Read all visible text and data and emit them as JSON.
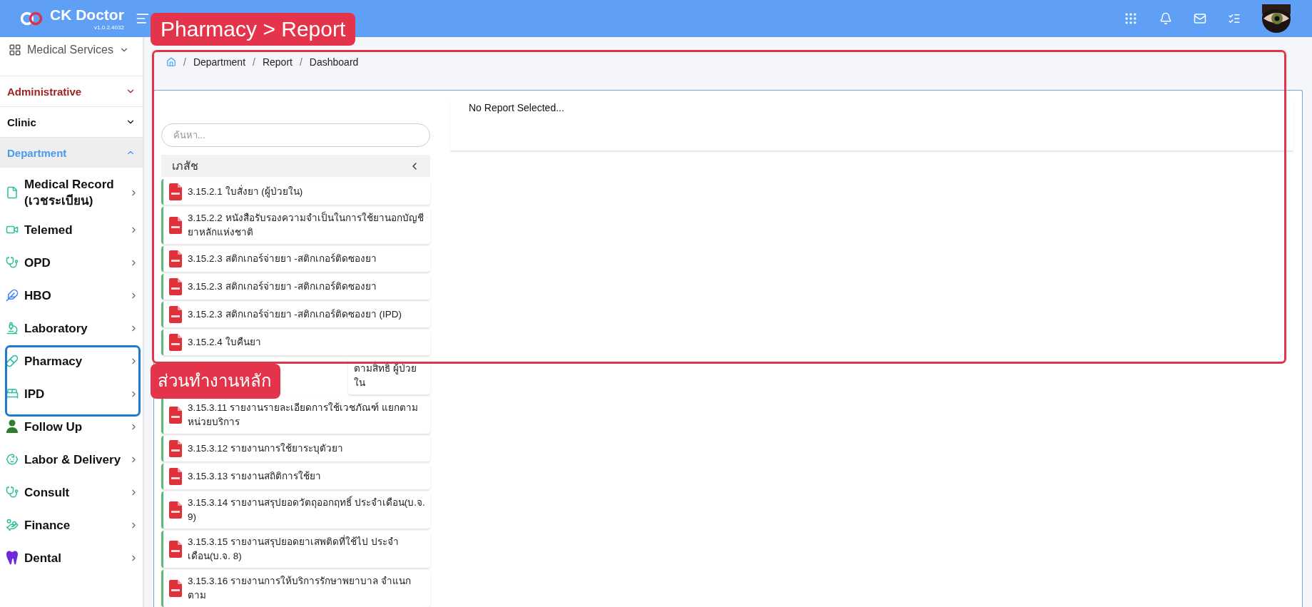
{
  "header": {
    "brand": "CK Doctor",
    "version": "v1.0.2.4032"
  },
  "sidebar": {
    "switcher": "Medical Services",
    "sections": [
      {
        "label": "Administrative",
        "color": "#9b2226",
        "expanded": false
      },
      {
        "label": "Clinic",
        "color": "#111111",
        "expanded": false
      },
      {
        "label": "Department",
        "color": "#4a9bf0",
        "expanded": true
      }
    ],
    "items": [
      {
        "label": "Medical Record (เวชระเบียน)",
        "kind": "file",
        "color": "#2bbf9f"
      },
      {
        "label": "Telemed",
        "kind": "video",
        "color": "#2bbf9f"
      },
      {
        "label": "OPD",
        "kind": "stethoscope",
        "color": "#2bbf9f"
      },
      {
        "label": "HBO",
        "kind": "feather",
        "color": "#3b82f6"
      },
      {
        "label": "Laboratory",
        "kind": "microscope",
        "color": "#2bbf9f"
      },
      {
        "label": "Pharmacy",
        "kind": "rx",
        "color": "#2bbf9f"
      },
      {
        "label": "IPD",
        "kind": "bed",
        "color": "#2bbf9f"
      },
      {
        "label": "Follow Up",
        "kind": "person",
        "color": "#2e7d32"
      },
      {
        "label": "Labor & Delivery",
        "kind": "baby",
        "color": "#2bbf9f"
      },
      {
        "label": "Consult",
        "kind": "stethoscope",
        "color": "#2bbf9f"
      },
      {
        "label": "Finance",
        "kind": "hand",
        "color": "#2bbf9f"
      },
      {
        "label": "Dental",
        "kind": "tooth",
        "color": "#6d28d9"
      }
    ]
  },
  "breadcrumb": {
    "separator": "/",
    "items": [
      "Department",
      "Report",
      "Dashboard"
    ]
  },
  "search": {
    "placeholder": "ค้นหา..."
  },
  "group": {
    "label": "เภสัช",
    "expanded": true
  },
  "reports": [
    {
      "label": "3.15.2.1 ใบสั่งยา (ผู้ป่วยใน)",
      "covered": false
    },
    {
      "label": "3.15.2.2 หนังสือรับรองความจำเป็นในการใช้ยานอกบัญชียาหลักแห่งชาติ",
      "covered": false
    },
    {
      "label": "3.15.2.3 สติกเกอร์จ่ายยา -สติกเกอร์ติดซองยา",
      "covered": false
    },
    {
      "label": "3.15.2.3 สติกเกอร์จ่ายยา -สติกเกอร์ติดซองยา",
      "covered": false
    },
    {
      "label": "3.15.2.3 สติกเกอร์จ่ายยา -สติกเกอร์ติดซองยา (IPD)",
      "covered": false
    },
    {
      "label": "3.15.2.4 ใบคืนยา",
      "covered": false
    },
    {
      "label": "ตามสิทธิ ผู้ป่วยใน",
      "covered": true
    },
    {
      "label": "3.15.3.11 รายงานรายละเอียดการใช้เวชภัณฑ์ แยกตามหน่วยบริการ",
      "covered": false
    },
    {
      "label": "3.15.3.12 รายงานการใช้ยาระบุตัวยา",
      "covered": false
    },
    {
      "label": "3.15.3.13 รายงานสถิติการใช้ยา",
      "covered": false
    },
    {
      "label": "3.15.3.14 รายงานสรุปยอดวัตถุออกฤทธิ์ ประจำเดือน(บ.จ. 9)",
      "covered": false
    },
    {
      "label": "3.15.3.15 รายงานสรุปยอดยาเสพติดที่ใช้ไป ประจำเดือน(บ.จ. 8)",
      "covered": false
    },
    {
      "label": "3.15.3.16 รายงานการให้บริการรักษาพยาบาล จำแนกตาม",
      "covered": false
    }
  ],
  "report_panel": {
    "message": "No Report Selected..."
  },
  "annotations": [
    {
      "kind": "callout",
      "text": "Pharmacy > Report"
    },
    {
      "kind": "frame",
      "color": "#e0344c"
    },
    {
      "kind": "callout",
      "text": "ส่วนทำงานหลัก"
    },
    {
      "kind": "frame",
      "color": "#1e7bd0"
    }
  ]
}
